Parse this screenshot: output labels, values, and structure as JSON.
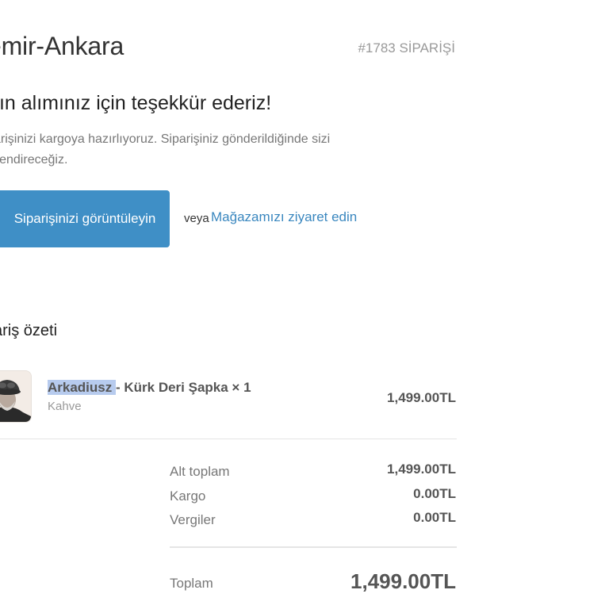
{
  "header": {
    "shop_name": "emir-Ankara",
    "order_number": "#1783 SİPARİŞİ"
  },
  "thanks": {
    "heading": "tın alımınız için teşekkür ederiz!",
    "message": "arişinizi kargoya hazırlıyoruz. Siparişiniz gönderildiğinde sizi ilendireceğiz."
  },
  "actions": {
    "view_order_label": "Siparişinizi görüntüleyin",
    "or_text": "veya",
    "visit_store_label": "Mağazamızı ziyaret edin"
  },
  "summary": {
    "heading": "ariş özeti",
    "item": {
      "title_highlight": "Arkadiusz ",
      "title_rest": "- Kürk Deri Şapka × 1",
      "variant": "Kahve",
      "price": "1,499.00TL",
      "image_icon": "product-photo-hat"
    },
    "subtotal_label": "Alt toplam",
    "subtotal_value": "1,499.00TL",
    "shipping_label": "Kargo",
    "shipping_value": "0.00TL",
    "taxes_label": "Vergiler",
    "taxes_value": "0.00TL",
    "total_label": "Toplam",
    "total_value": "1,499.00TL"
  },
  "colors": {
    "accent": "#3f8fc6",
    "link": "#3a87bf",
    "highlight": "#b7cbee"
  }
}
